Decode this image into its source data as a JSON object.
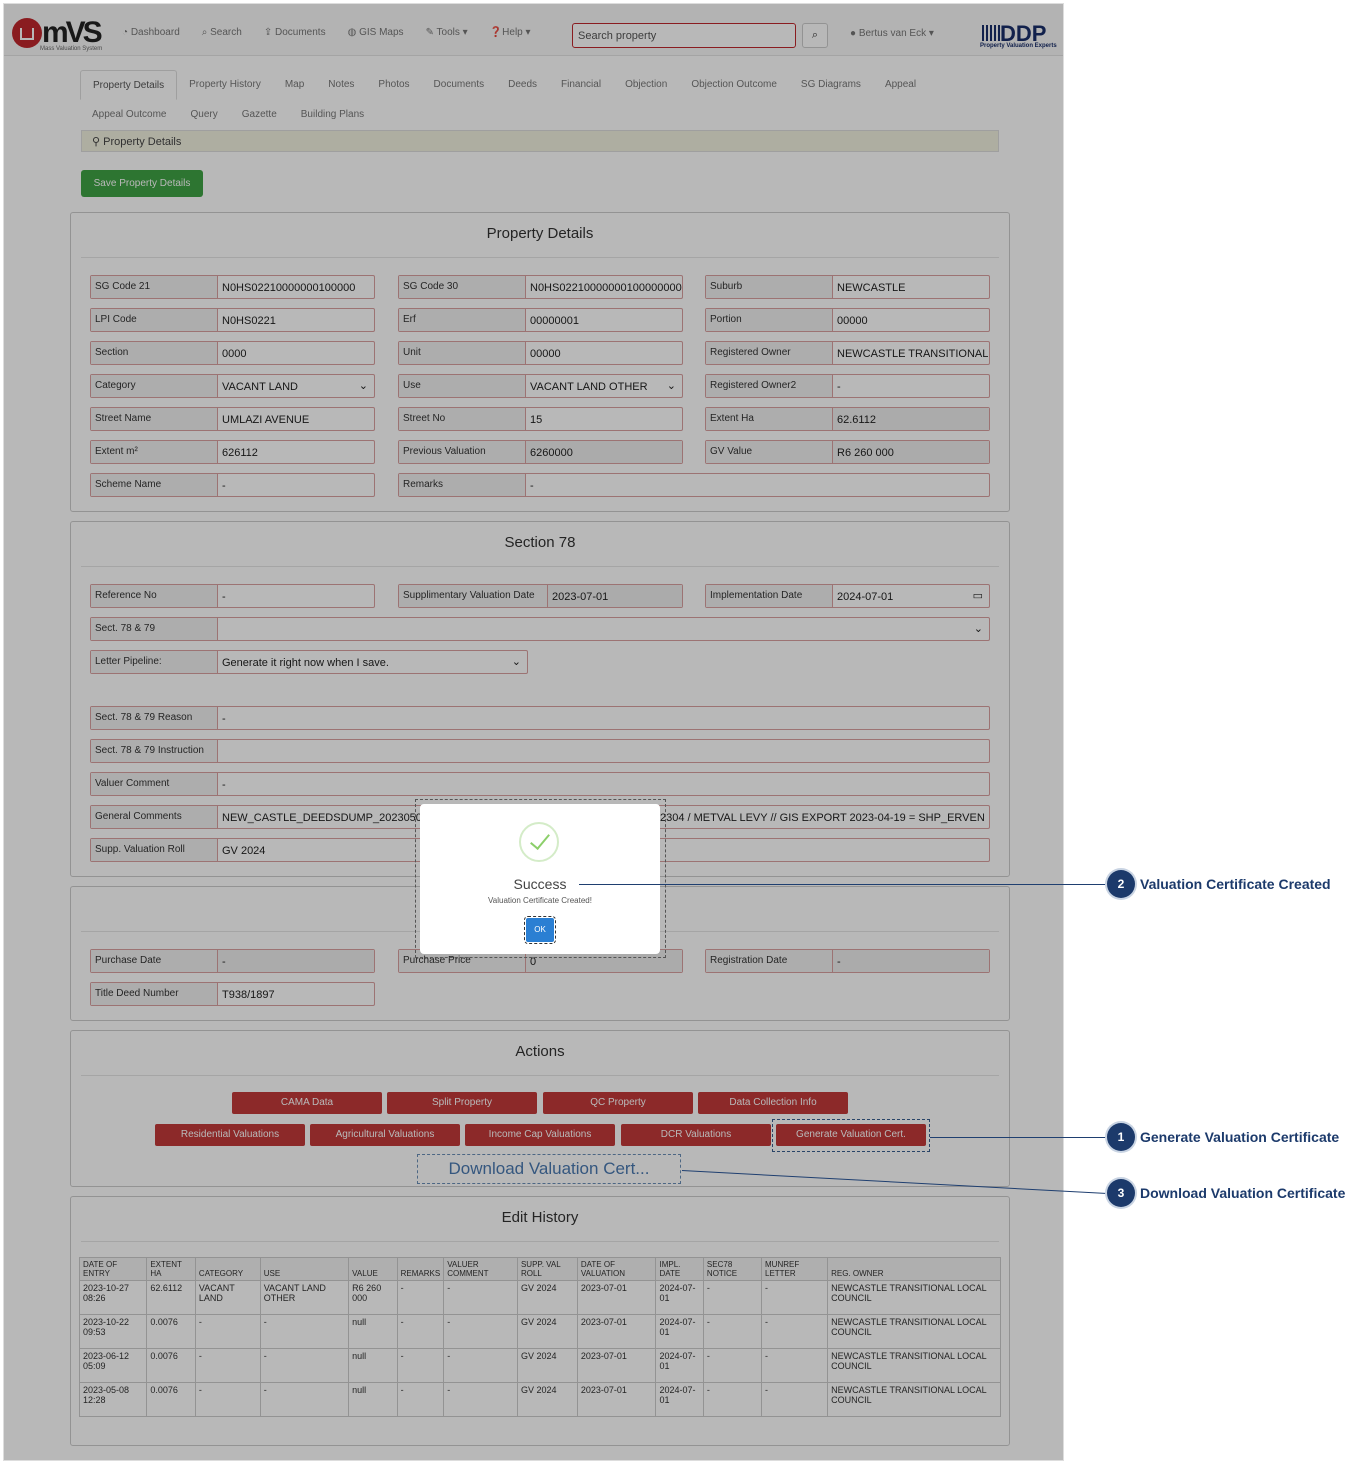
{
  "nav": {
    "logo_text": "mVS",
    "logo_sub": "Mass Valuation System",
    "links": [
      "Dashboard",
      "Search",
      "Documents",
      "GIS Maps",
      "Tools",
      "Help"
    ],
    "search_placeholder": "Search property",
    "user": "Bertus van Eck",
    "brand": "DDP",
    "brand_sub": "Property Valuation Experts"
  },
  "tabs_row1": [
    "Property Details",
    "Property History",
    "Map",
    "Notes",
    "Photos",
    "Documents",
    "Deeds",
    "Financial",
    "Objection",
    "Objection Outcome",
    "SG Diagrams",
    "Appeal"
  ],
  "tabs_row2": [
    "Appeal Outcome",
    "Query",
    "Gazette",
    "Building Plans"
  ],
  "breadcrumb": "Property Details",
  "save_button": "Save Property Details",
  "property_details": {
    "title": "Property Details",
    "fields": [
      {
        "label": "SG Code 21",
        "value": "N0HS02210000000100000"
      },
      {
        "label": "SG Code 30",
        "value": "N0HS02210000000100000000"
      },
      {
        "label": "Suburb",
        "value": "NEWCASTLE"
      },
      {
        "label": "LPI Code",
        "value": "N0HS0221"
      },
      {
        "label": "Erf",
        "value": "00000001"
      },
      {
        "label": "Portion",
        "value": "00000"
      },
      {
        "label": "Section",
        "value": "0000"
      },
      {
        "label": "Unit",
        "value": "00000"
      },
      {
        "label": "Registered Owner",
        "value": "NEWCASTLE TRANSITIONAL L"
      },
      {
        "label": "Category",
        "value": "VACANT LAND"
      },
      {
        "label": "Use",
        "value": "VACANT LAND OTHER"
      },
      {
        "label": "Registered Owner2",
        "value": "-"
      },
      {
        "label": "Street Name",
        "value": "UMLAZI AVENUE"
      },
      {
        "label": "Street No",
        "value": "15"
      },
      {
        "label": "Extent Ha",
        "value": "62.6112"
      },
      {
        "label": "Extent m²",
        "value": "626112"
      },
      {
        "label": "Previous Valuation",
        "value": "6260000"
      },
      {
        "label": "GV Value",
        "value": "R6 260 000"
      },
      {
        "label": "Scheme Name",
        "value": "-"
      },
      {
        "label": "Remarks",
        "value": "-"
      }
    ]
  },
  "section78": {
    "title": "Section 78",
    "fields": [
      {
        "label": "Reference No",
        "value": "-"
      },
      {
        "label": "Supplimentary Valuation Date",
        "value": "2023-07-01"
      },
      {
        "label": "Implementation Date",
        "value": "2024-07-01"
      },
      {
        "label": "Sect. 78 & 79",
        "value": ""
      },
      {
        "label": "Letter Pipeline:",
        "value": "Generate it right now when I save."
      },
      {
        "label": "Sect. 78 & 79 Reason",
        "value": "-"
      },
      {
        "label": "Sect. 78 & 79 Instruction",
        "value": ""
      },
      {
        "label": "Valuer Comment",
        "value": "-"
      },
      {
        "label": "General Comments",
        "value": "NEW_CASTLE_DEEDSDUMP_20230505"
      },
      {
        "label": "Supp. Valuation Roll",
        "value": "GV 2024"
      }
    ],
    "general_comments_tail": "2304 / METVAL LEVY // GIS EXPORT 2023-04-19 = SHP_ERVEN"
  },
  "purchase": {
    "fields": [
      {
        "label": "Purchase Date",
        "value": "-"
      },
      {
        "label": "Purchase Price",
        "value": "0"
      },
      {
        "label": "Registration Date",
        "value": "-"
      },
      {
        "label": "Title Deed Number",
        "value": "T938/1897"
      }
    ]
  },
  "actions": {
    "title": "Actions",
    "row1": [
      "CAMA Data",
      "Split Property",
      "QC Property",
      "Data Collection Info"
    ],
    "row2": [
      "Residential Valuations",
      "Agricultural Valuations",
      "Income Cap Valuations",
      "DCR Valuations",
      "Generate Valuation Cert."
    ],
    "download": "Download Valuation Cert..."
  },
  "edit_history": {
    "title": "Edit History",
    "headers": [
      "DATE OF ENTRY",
      "EXTENT HA",
      "CATEGORY",
      "USE",
      "VALUE",
      "REMARKS",
      "VALUER COMMENT",
      "SUPP. VAL ROLL",
      "DATE OF VALUATION",
      "IMPL. DATE",
      "SEC78 NOTICE",
      "MUNREF LETTER",
      "REG. OWNER"
    ],
    "rows": [
      [
        "2023-10-27 08:26",
        "62.6112",
        "VACANT LAND",
        "VACANT LAND OTHER",
        "R6 260 000",
        "-",
        "-",
        "GV 2024",
        "2023-07-01",
        "2024-07-01",
        "-",
        "-",
        "NEWCASTLE TRANSITIONAL LOCAL COUNCIL"
      ],
      [
        "2023-10-22 09:53",
        "0.0076",
        "-",
        "-",
        "null",
        "-",
        "-",
        "GV 2024",
        "2023-07-01",
        "2024-07-01",
        "-",
        "-",
        "NEWCASTLE TRANSITIONAL LOCAL COUNCIL"
      ],
      [
        "2023-06-12 05:09",
        "0.0076",
        "-",
        "-",
        "null",
        "-",
        "-",
        "GV 2024",
        "2023-07-01",
        "2024-07-01",
        "-",
        "-",
        "NEWCASTLE TRANSITIONAL LOCAL COUNCIL"
      ],
      [
        "2023-05-08 12:28",
        "0.0076",
        "-",
        "-",
        "null",
        "-",
        "-",
        "GV 2024",
        "2023-07-01",
        "2024-07-01",
        "-",
        "-",
        "NEWCASTLE TRANSITIONAL LOCAL COUNCIL"
      ]
    ]
  },
  "modal": {
    "title": "Success",
    "message": "Valuation Certificate Created!",
    "ok": "OK"
  },
  "callouts": [
    {
      "num": "1",
      "text": "Generate Valuation Certificate"
    },
    {
      "num": "2",
      "text": "Valuation Certificate Created"
    },
    {
      "num": "3",
      "text": "Download Valuation Certificate"
    }
  ]
}
